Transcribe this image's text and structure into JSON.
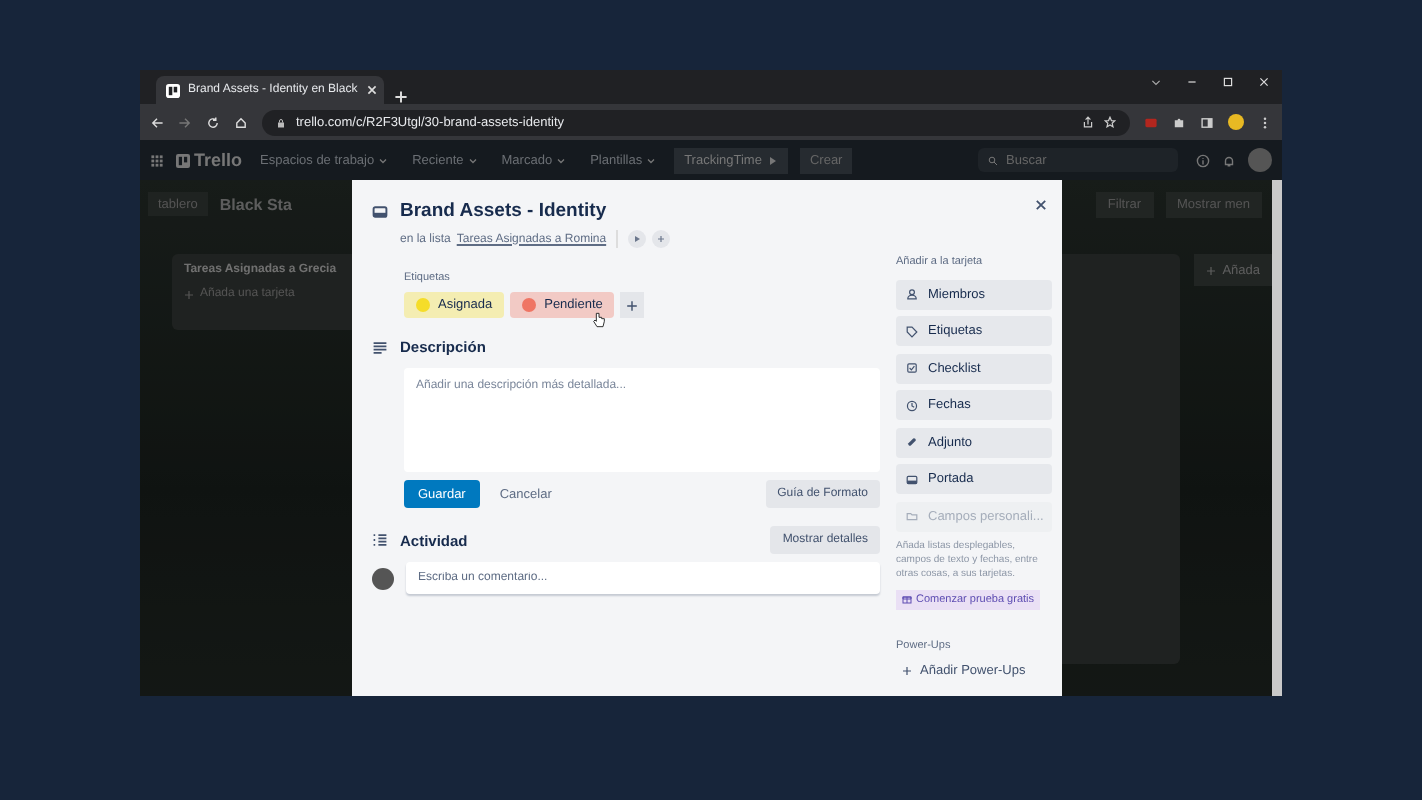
{
  "browser": {
    "tab_title": "Brand Assets - Identity en Black",
    "url": "trello.com/c/R2F3Utgl/30-brand-assets-identity"
  },
  "header": {
    "logo": "Trello",
    "nav": [
      "Espacios de trabajo",
      "Reciente",
      "Marcado",
      "Plantillas"
    ],
    "tracking": "TrackingTime",
    "create": "Crear",
    "search_placeholder": "Buscar"
  },
  "board": {
    "view": "tablero",
    "title": "Black Sta",
    "filter": "Filtrar",
    "menu": "Mostrar men",
    "list_title": "Tareas Asignadas a Grecia",
    "add_card": "Añada una tarjeta",
    "add_list": "Añada"
  },
  "card": {
    "title": "Brand Assets - Identity",
    "list_prefix": "en la lista",
    "list_link": "Tareas Asignadas a Romina",
    "labels_heading": "Etiquetas",
    "labels": [
      {
        "name": "Asignada",
        "color": "#f5dd29"
      },
      {
        "name": "Pendiente",
        "color": "#ef7564"
      }
    ],
    "description_heading": "Descripción",
    "description_placeholder": "Añadir una descripción más detallada...",
    "save": "Guardar",
    "cancel": "Cancelar",
    "format_guide": "Guía de Formato",
    "activity_heading": "Actividad",
    "show_details": "Mostrar detalles",
    "comment_placeholder": "Escriba un comentario..."
  },
  "sidebar": {
    "heading": "Añadir a la tarjeta",
    "items": [
      {
        "label": "Miembros",
        "kind": "members",
        "disabled": false
      },
      {
        "label": "Etiquetas",
        "kind": "labels",
        "disabled": false
      },
      {
        "label": "Checklist",
        "kind": "checklist",
        "disabled": false
      },
      {
        "label": "Fechas",
        "kind": "dates",
        "disabled": false
      },
      {
        "label": "Adjunto",
        "kind": "attachment",
        "disabled": false
      },
      {
        "label": "Portada",
        "kind": "cover",
        "disabled": false
      },
      {
        "label": "Campos personali...",
        "kind": "fields",
        "disabled": true
      }
    ],
    "note": "Añada listas desplegables, campos de texto y fechas, entre otras cosas, a sus tarjetas.",
    "trial": "Comenzar prueba gratis",
    "powerups_heading": "Power-Ups",
    "add_powerups": "Añadir Power-Ups"
  }
}
